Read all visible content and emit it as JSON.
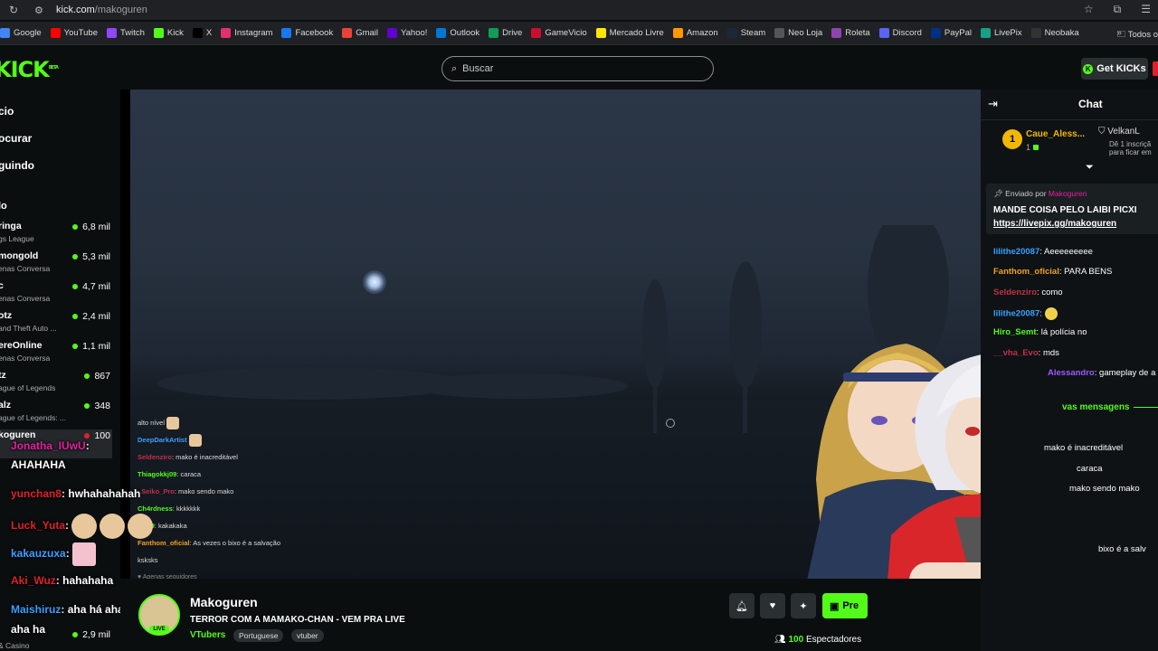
{
  "browser": {
    "url_domain": "kick.com",
    "url_path": "/makoguren",
    "bookmarks": [
      {
        "label": "Google",
        "icon": "google-icon",
        "color": "#4285f4"
      },
      {
        "label": "YouTube",
        "icon": "youtube-icon",
        "color": "#ff0000"
      },
      {
        "label": "Twitch",
        "icon": "twitch-icon",
        "color": "#9146ff"
      },
      {
        "label": "Kick",
        "icon": "kick-icon",
        "color": "#53fc18"
      },
      {
        "label": "X",
        "icon": "x-icon",
        "color": "#000000"
      },
      {
        "label": "Instagram",
        "icon": "instagram-icon",
        "color": "#e1306c"
      },
      {
        "label": "Facebook",
        "icon": "facebook-icon",
        "color": "#1877f2"
      },
      {
        "label": "Gmail",
        "icon": "gmail-icon",
        "color": "#ea4335"
      },
      {
        "label": "Yahoo!",
        "icon": "yahoo-icon",
        "color": "#6001d2"
      },
      {
        "label": "Outlook",
        "icon": "outlook-icon",
        "color": "#0078d4"
      },
      {
        "label": "Drive",
        "icon": "drive-icon",
        "color": "#0f9d58"
      },
      {
        "label": "GameVicio",
        "icon": "gamevicio-icon",
        "color": "#c8102e"
      },
      {
        "label": "Mercado Livre",
        "icon": "mercadolivre-icon",
        "color": "#ffe600"
      },
      {
        "label": "Amazon",
        "icon": "amazon-icon",
        "color": "#ff9900"
      },
      {
        "label": "Steam",
        "icon": "steam-icon",
        "color": "#1b2838"
      },
      {
        "label": "Neo Loja",
        "icon": "neoloja-icon",
        "color": "#555555"
      },
      {
        "label": "Roleta",
        "icon": "roleta-icon",
        "color": "#8e44ad"
      },
      {
        "label": "Discord",
        "icon": "discord-icon",
        "color": "#5865f2"
      },
      {
        "label": "PayPal",
        "icon": "paypal-icon",
        "color": "#003087"
      },
      {
        "label": "LivePix",
        "icon": "livepix-icon",
        "color": "#16a085"
      },
      {
        "label": "Neobaka",
        "icon": "neobaka-icon",
        "color": "#333333"
      }
    ],
    "bookmarks_more": "»",
    "all_bookmarks": "Todos o"
  },
  "header": {
    "logo": "KICK",
    "logo_sup": "BETA",
    "search_placeholder": "Buscar",
    "get_kicks_label": "Get KICKs"
  },
  "sidebar": {
    "nav": [
      "cio",
      "ocurar",
      "guindo"
    ],
    "recommended_title": "lo",
    "channels": [
      {
        "name": "ringa",
        "category": "gs League",
        "viewers": "6,8 mil"
      },
      {
        "name": "mongold",
        "category": "enas Conversa",
        "viewers": "5,3 mil"
      },
      {
        "name": "c",
        "category": "enas Conversa",
        "viewers": "4,7 mil"
      },
      {
        "name": "otz",
        "category": "and Theft Auto ...",
        "viewers": "2,4 mil"
      },
      {
        "name": "ereOnline",
        "category": "enas Conversa",
        "viewers": "1,1 mil"
      },
      {
        "name": "tz",
        "category": "ague of Legends",
        "viewers": "867"
      },
      {
        "name": "alz",
        "category": "ague of Legends: ...",
        "viewers": "348"
      },
      {
        "name": "koguren",
        "category": "",
        "viewers": "100"
      }
    ],
    "bottom_viewers": "2,9 mil",
    "bottom_category": "& Casino"
  },
  "overlay_chat": [
    {
      "user": "",
      "text": "alto nível",
      "color": "#dddddd"
    },
    {
      "user": "DeepDarkArtist",
      "text": "",
      "color": "#3aa0ff"
    },
    {
      "user": "Seldenziro",
      "text": "mako é inacreditável",
      "color": "#c0304a"
    },
    {
      "user": "Thiagokkj09",
      "text": "caraca",
      "color": "#53fc18"
    },
    {
      "user": "_Seiko_Pro",
      "text": "mako sendo mako",
      "color": "#c0304a"
    },
    {
      "user": "Ch4rdness",
      "text": "kkkkkkk",
      "color": "#53fc18"
    },
    {
      "user": "kkj09",
      "text": "kakakaka",
      "color": "#53fc18"
    },
    {
      "user": "Fanthom_oficial",
      "text": "As vezes o bixo é a salvação ksksks",
      "color": "#f0a020"
    }
  ],
  "overlay_footer": "♥ Apenas seguidores",
  "left_chat": [
    {
      "user": "Jonatha_IUwU",
      "text": "",
      "color": "#e91ea5"
    },
    {
      "user": "",
      "text": "AHAHAHA",
      "color": "#ffffff"
    },
    {
      "user": "yunchan8",
      "text": "hwhahahahah",
      "color": "#e0212b"
    },
    {
      "user": "Luck_Yuta",
      "text": "",
      "color": "#e0212b"
    },
    {
      "user": "kakauzuxa",
      "text": "",
      "color": "#3aa0ff"
    },
    {
      "user": "Aki_Wuz",
      "text": "hahahaha",
      "color": "#e0212b"
    },
    {
      "user": "Maishiruz",
      "text": "aha há aha há",
      "color": "#3aa0ff"
    },
    {
      "user": "",
      "text": "aha ha",
      "color": "#ffffff"
    }
  ],
  "stream": {
    "streamer": "Makoguren",
    "title": "TERROR COM A MAMAKO-CHAN - VEM PRA LIVE",
    "category": "VTubers",
    "tags": [
      "Portuguese",
      "vtuber"
    ],
    "avatar_badge": "LIVE",
    "subscribe_label": "Pre",
    "viewers_count": "100",
    "viewers_label": "Espectadores"
  },
  "chat": {
    "title": "Chat",
    "top_gifter": {
      "name": "Caue_Aless...",
      "count": "1",
      "rank": "1"
    },
    "second": {
      "name": "VelkanL",
      "sub_1": "Dê 1 inscriçã",
      "sub_2": "para ficar em"
    },
    "pinned": {
      "by_label": "Enviado por",
      "by_user": "Makoguren",
      "line1": "MANDE COISA PELO LAIBI PICXI",
      "line2": "https://livepix.gg/makoguren"
    },
    "messages": [
      {
        "user": "lilithe20087",
        "text": "Aeeeeeeeee",
        "color": "#3aa0ff"
      },
      {
        "user": "Fanthom_oficial",
        "text": "PARA BENS",
        "color": "#f0a020"
      },
      {
        "user": "Seldenziro",
        "text": "como",
        "color": "#c0304a"
      },
      {
        "user": "lilithe20087",
        "text": "",
        "color": "#3aa0ff"
      },
      {
        "user": "Hiro_Semt",
        "text": "lá polícia no",
        "color": "#53fc18"
      },
      {
        "user": "__vha_Evo",
        "text": "mds",
        "color": "#c0304a"
      },
      {
        "user": "Alessandro",
        "text": "gameplay de a",
        "color": "#9b59ff"
      }
    ],
    "new_messages": "vas mensagens",
    "after_messages": [
      {
        "user": "",
        "text": "mako é inacreditável",
        "color": "#ffffff"
      },
      {
        "user": "",
        "text": "caraca",
        "color": "#ffffff"
      },
      {
        "user": "",
        "text": "mako sendo mako",
        "color": "#ffffff"
      },
      {
        "user": "",
        "text": "bixo é a salv",
        "color": "#ffffff"
      }
    ]
  }
}
